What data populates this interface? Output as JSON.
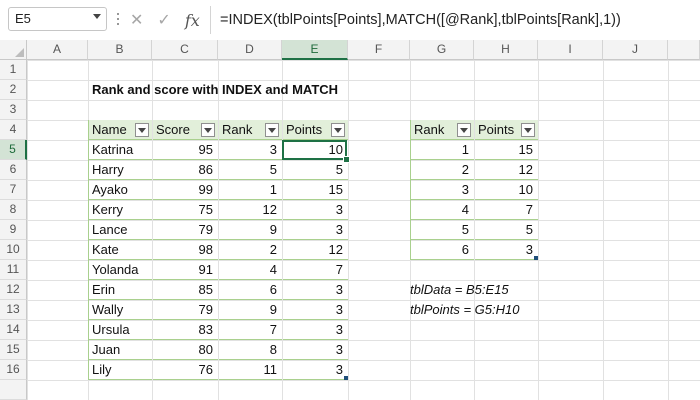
{
  "formula_bar": {
    "name_box": "E5",
    "cancel_icon": "✕",
    "enter_icon": "✓",
    "fx_label": "fx",
    "formula": "=INDEX(tblPoints[Points],MATCH([@Rank],tblPoints[Rank],1))"
  },
  "columns": [
    "A",
    "B",
    "C",
    "D",
    "E",
    "F",
    "G",
    "H",
    "I",
    "J"
  ],
  "rows": [
    "1",
    "2",
    "3",
    "4",
    "5",
    "6",
    "7",
    "8",
    "9",
    "10",
    "11",
    "12",
    "13",
    "14",
    "15",
    "16"
  ],
  "selected_column": "E",
  "selected_row": "5",
  "title": "Rank and score with INDEX and MATCH",
  "tblData": {
    "headers": [
      "Name",
      "Score",
      "Rank",
      "Points"
    ],
    "rows": [
      [
        "Katrina",
        "95",
        "3",
        "10"
      ],
      [
        "Harry",
        "86",
        "5",
        "5"
      ],
      [
        "Ayako",
        "99",
        "1",
        "15"
      ],
      [
        "Kerry",
        "75",
        "12",
        "3"
      ],
      [
        "Lance",
        "79",
        "9",
        "3"
      ],
      [
        "Kate",
        "98",
        "2",
        "12"
      ],
      [
        "Yolanda",
        "91",
        "4",
        "7"
      ],
      [
        "Erin",
        "85",
        "6",
        "3"
      ],
      [
        "Wally",
        "79",
        "9",
        "3"
      ],
      [
        "Ursula",
        "83",
        "7",
        "3"
      ],
      [
        "Juan",
        "80",
        "8",
        "3"
      ],
      [
        "Lily",
        "76",
        "11",
        "3"
      ]
    ]
  },
  "tblPoints": {
    "headers": [
      "Rank",
      "Points"
    ],
    "rows": [
      [
        "1",
        "15"
      ],
      [
        "2",
        "12"
      ],
      [
        "3",
        "10"
      ],
      [
        "4",
        "7"
      ],
      [
        "5",
        "5"
      ],
      [
        "6",
        "3"
      ]
    ]
  },
  "notes": {
    "tbl_data": "tblData = B5:E15",
    "tbl_points": "tblPoints = G5:H10"
  },
  "colors": {
    "accent": "#1e7145",
    "table_header": "#e2efda",
    "table_border": "#a9d08e"
  }
}
